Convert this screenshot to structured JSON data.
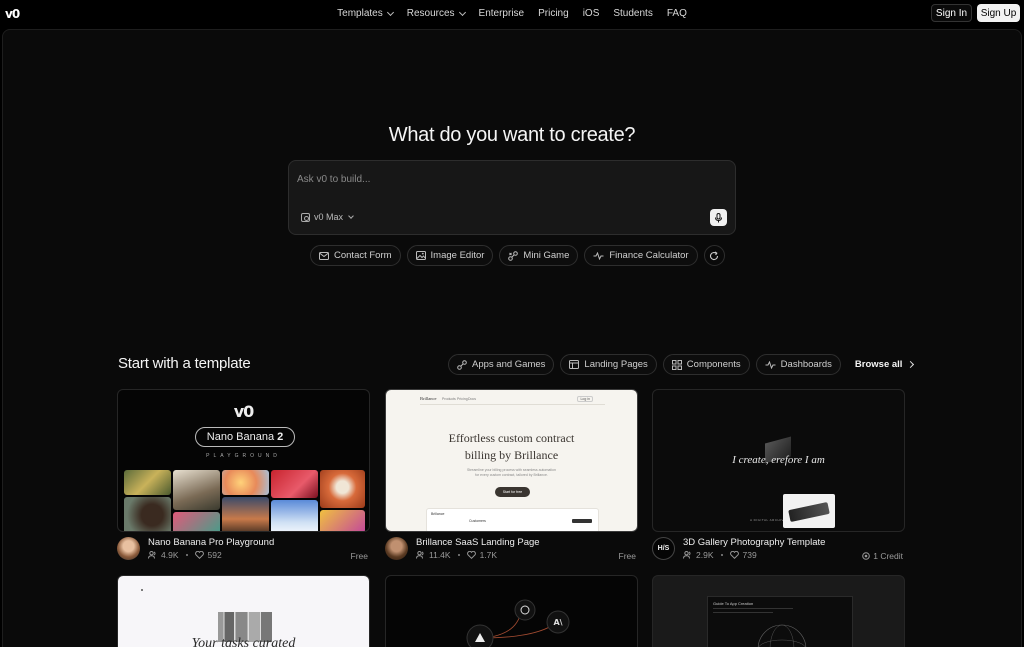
{
  "nav": {
    "logo": "v0",
    "links": [
      {
        "label": "Templates",
        "dropdown": true
      },
      {
        "label": "Resources",
        "dropdown": true
      },
      {
        "label": "Enterprise",
        "dropdown": false
      },
      {
        "label": "Pricing",
        "dropdown": false
      },
      {
        "label": "iOS",
        "dropdown": false
      },
      {
        "label": "Students",
        "dropdown": false
      },
      {
        "label": "FAQ",
        "dropdown": false
      }
    ],
    "sign_in": "Sign In",
    "sign_up": "Sign Up"
  },
  "hero": {
    "title": "What do you want to create?",
    "placeholder": "Ask v0 to build...",
    "model": "v0 Max"
  },
  "suggestions": [
    {
      "label": "Contact Form",
      "icon": "mail-icon"
    },
    {
      "label": "Image Editor",
      "icon": "image-icon"
    },
    {
      "label": "Mini Game",
      "icon": "game-icon"
    },
    {
      "label": "Finance Calculator",
      "icon": "activity-icon"
    }
  ],
  "templates": {
    "title": "Start with a template",
    "filters": [
      {
        "label": "Apps and Games",
        "icon": "apps-icon"
      },
      {
        "label": "Landing Pages",
        "icon": "layout-icon"
      },
      {
        "label": "Components",
        "icon": "grid-icon"
      },
      {
        "label": "Dashboards",
        "icon": "activity-icon"
      }
    ],
    "browse_all": "Browse all",
    "cards": [
      {
        "title": "Nano Banana Pro Playground",
        "users": "4.9K",
        "likes": "592",
        "price": "Free",
        "thumb": {
          "logo": "v0",
          "badge_text": "Nano Banana",
          "badge_num": "2",
          "sub": "PLAYGROUND"
        }
      },
      {
        "title": "Brillance SaaS Landing Page",
        "users": "11.4K",
        "likes": "1.7K",
        "price": "Free",
        "thumb": {
          "brand": "Brillance",
          "nav": [
            "Products",
            "Pricing",
            "Docs"
          ],
          "login": "Log in",
          "headline1": "Effortless custom contract",
          "headline2": "billing by Brillance",
          "sub1": "Streamline your billing process with seamless automation",
          "sub2": "for every custom contract, tailored by Brillance.",
          "cta": "Start for free",
          "mock_title": "Brillance",
          "mock_heading": "Customers"
        }
      },
      {
        "title": "3D Gallery Photography Template",
        "users": "2.9K",
        "likes": "739",
        "price": "1 Credit",
        "avatar_text": "H/S",
        "thumb": {
          "text_a": "I create,",
          "text_b": "erefore I am",
          "caption": "A DIGITAL ARCHIVE OF PHOTOGRAPHY"
        }
      }
    ],
    "row2": [
      {
        "text": "Your tasks curated"
      },
      {},
      {
        "heading": "Guide To App Creation"
      }
    ]
  },
  "colors": {
    "background": "#000000",
    "panel": "#0a0a0a",
    "accent": "#ffffff"
  }
}
